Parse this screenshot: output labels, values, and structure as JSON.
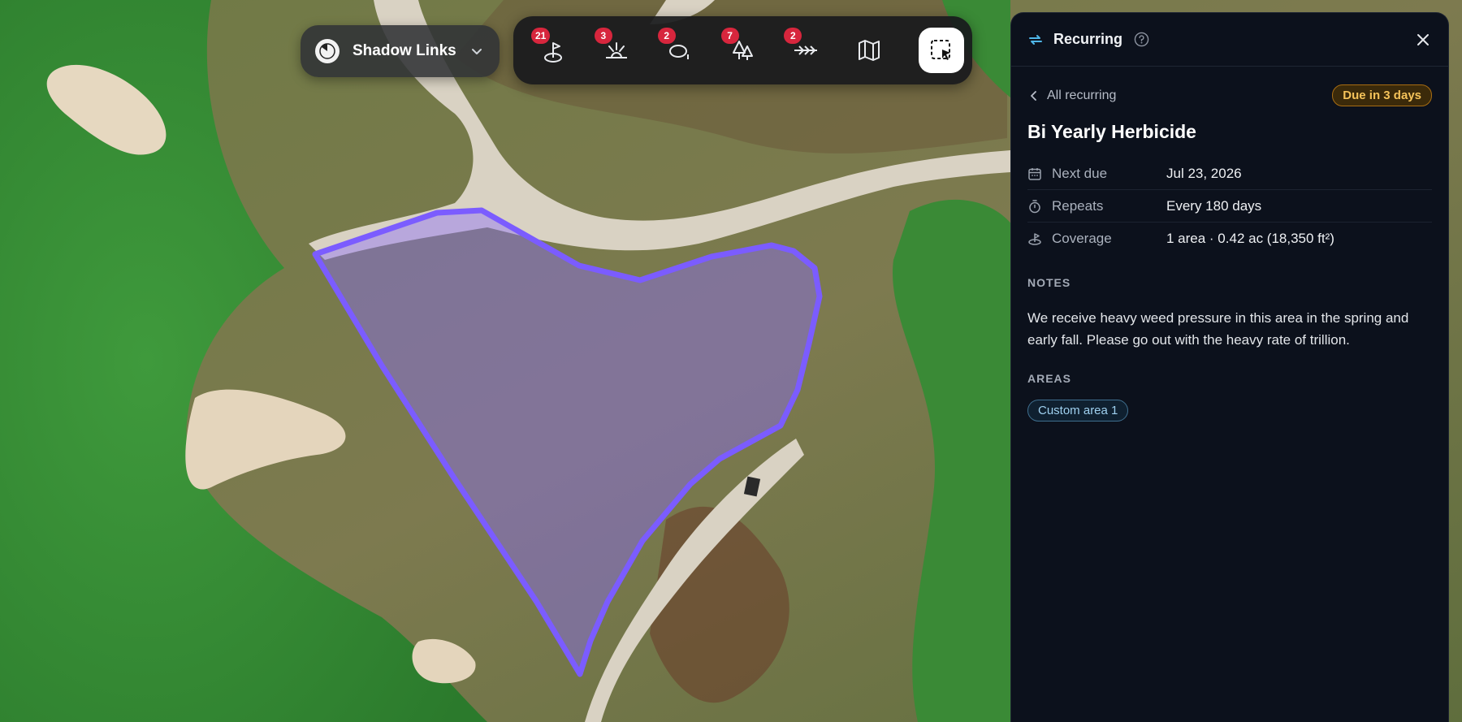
{
  "course": {
    "name": "Shadow Links"
  },
  "toolbar": {
    "tools": [
      {
        "icon": "pin-flag-icon",
        "badge": "21"
      },
      {
        "icon": "sprinkler-icon",
        "badge": "3"
      },
      {
        "icon": "disc-icon",
        "badge": "2"
      },
      {
        "icon": "trees-icon",
        "badge": "7"
      },
      {
        "icon": "arrows-icon",
        "badge": "2"
      },
      {
        "icon": "map-icon",
        "badge": ""
      },
      {
        "icon": "select-area-icon",
        "badge": ""
      }
    ]
  },
  "panel": {
    "header_title": "Recurring",
    "back_label": "All recurring",
    "due_badge": "Due in 3 days",
    "title": "Bi Yearly Herbicide",
    "properties": [
      {
        "icon": "calendar-icon",
        "label": "Next due",
        "value": "Jul 23, 2026"
      },
      {
        "icon": "stopwatch-icon",
        "label": "Repeats",
        "value": "Every 180 days"
      },
      {
        "icon": "coverage-icon",
        "label": "Coverage",
        "value": "1 area · 0.42 ac (18,350 ft²)"
      }
    ],
    "notes_heading": "NOTES",
    "notes": "We receive heavy weed pressure in this area in the spring and early fall. Please go out with the heavy rate of trillion.",
    "areas_heading": "AREAS",
    "areas": [
      "Custom area 1"
    ]
  },
  "colors": {
    "accent": "#7b5cff",
    "due_text": "#f5c35a",
    "panel_bg": "#0c111c",
    "fairway": "#2f7a2f"
  }
}
